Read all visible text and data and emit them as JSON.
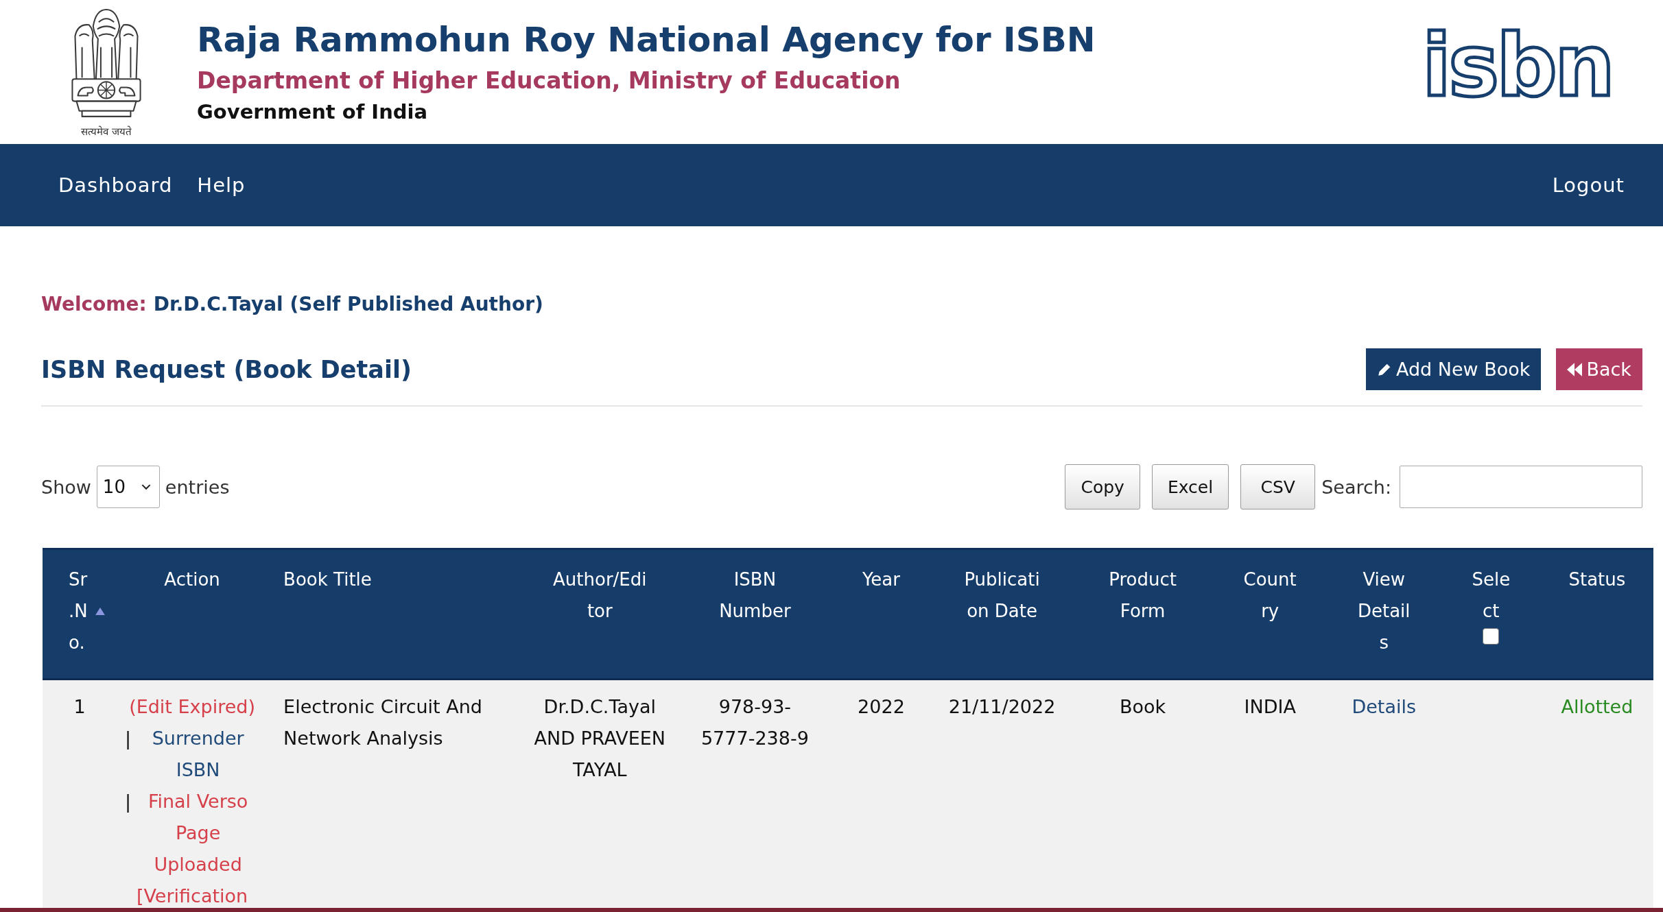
{
  "header": {
    "emblem_motto": "सत्यमेव जयते",
    "title": "Raja Rammohun Roy National Agency for ISBN",
    "subtitle": "Department of Higher Education, Ministry of Education",
    "government": "Government of India",
    "logo_text": "isbn"
  },
  "nav": {
    "items": [
      {
        "label": "Dashboard"
      },
      {
        "label": "Help"
      }
    ],
    "logout": "Logout"
  },
  "welcome": {
    "label": "Welcome:",
    "name": "Dr.D.C.Tayal (Self Published Author)"
  },
  "page_title": "ISBN Request (Book Detail)",
  "actions": [
    {
      "label": "Add New Book",
      "kind": "add"
    },
    {
      "label": "Back",
      "kind": "back"
    }
  ],
  "table_controls": {
    "show_label": "Show",
    "length": "10",
    "entries_label": "entries",
    "export_buttons": [
      "Copy",
      "Excel",
      "CSV"
    ],
    "search_label": "Search:"
  },
  "table": {
    "columns": [
      {
        "label": "Sr.No.",
        "sorted": true
      },
      {
        "label": "Action",
        "sorted": false
      },
      {
        "label": "Book Title",
        "sorted": false
      },
      {
        "label": "Author/Editor",
        "sorted": false
      },
      {
        "label": "ISBN Number",
        "sorted": false
      },
      {
        "label": "Year",
        "sorted": false
      },
      {
        "label": "Publication Date",
        "sorted": false
      },
      {
        "label": "Product Form",
        "sorted": false
      },
      {
        "label": "Country",
        "sorted": false
      },
      {
        "label": "View Details",
        "sorted": false
      },
      {
        "label": "Select",
        "sorted": false,
        "checkbox": {
          "checked": false
        }
      },
      {
        "label": "Status",
        "sorted": false
      }
    ],
    "rows": [
      {
        "sr_no": "1",
        "action_links": [
          {
            "label": "(Edit Expired)",
            "color": "#d6404a"
          },
          {
            "prefix": "|",
            "label": "Surrender ISBN",
            "color": "#1f4a7a"
          },
          {
            "prefix": "|",
            "label": "Final Verso Page Uploaded",
            "color": "#d6404a"
          },
          {
            "label": "[Verification",
            "color": "#d6404a"
          }
        ],
        "book_title": "Electronic Circuit And Network Analysis",
        "author": "Dr.D.C.Tayal AND PRAVEEN TAYAL",
        "isbn": "978-93-5777-238-9",
        "year": "2022",
        "publication_date": "21/11/2022",
        "product_form": "Book",
        "country": "INDIA",
        "details_link": "Details",
        "status": "Allotted"
      }
    ]
  }
}
